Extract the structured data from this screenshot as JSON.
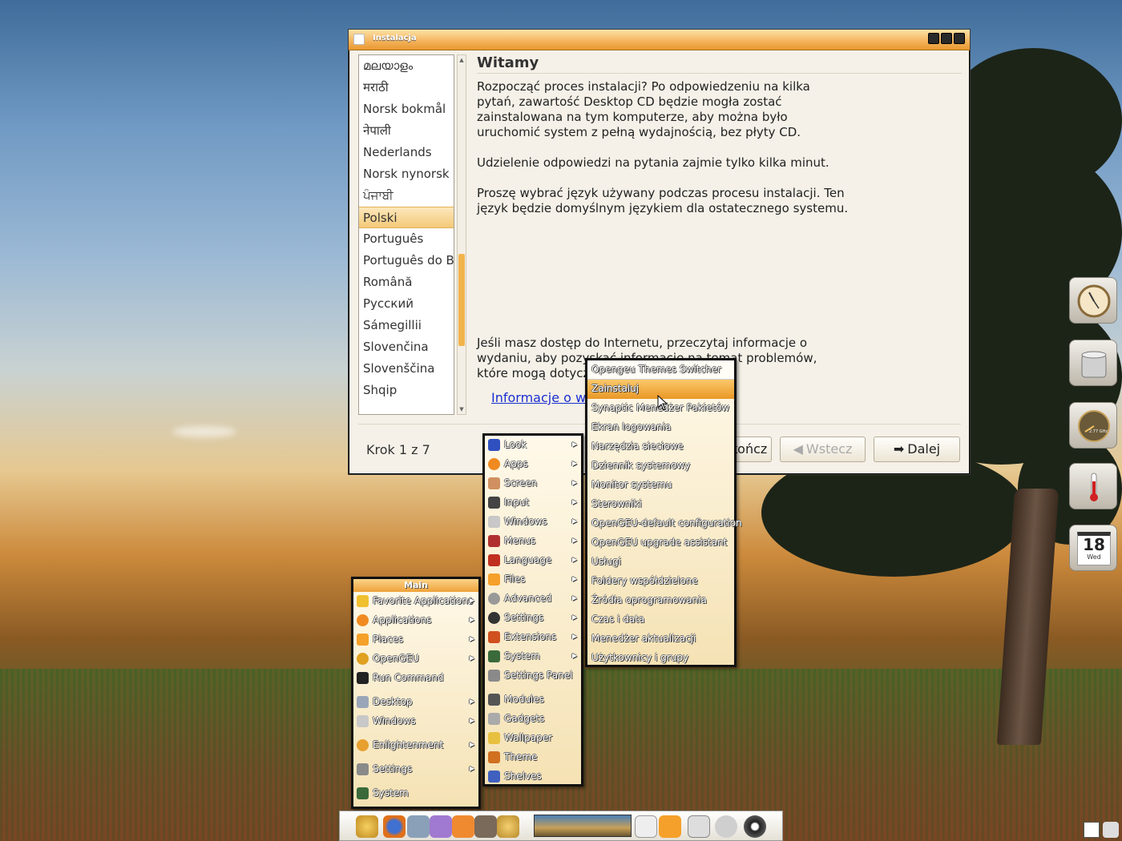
{
  "installer": {
    "title": "Instalacja",
    "languages": [
      "മലയാളം",
      "मराठी",
      "Norsk bokmål",
      "नेपाली",
      "Nederlands",
      "Norsk nynorsk",
      "ਪੰਜਾਬੀ",
      "Polski",
      "Português",
      "Português do Brasil",
      "Română",
      "Русский",
      "Sámegillii",
      "Slovenčina",
      "Slovenščina",
      "Shqip"
    ],
    "selected_language": "Polski",
    "heading": "Witamy",
    "para1": "Rozpocząć proces instalacji? Po odpowiedzeniu na kilka pytań, zawartość Desktop CD będzie mogła zostać zainstalowana na tym komputerze, aby można było uruchomić system z pełną wydajnością, bez płyty CD.",
    "para2": "Udzielenie odpowiedzi na pytania zajmie tylko kilka minut.",
    "para3": "Proszę wybrać język używany podczas procesu instalacji. Ten język będzie domyślnym językiem dla ostatecznego systemu.",
    "para4": "Jeśli masz dostęp do Internetu, przeczytaj informacje o wydaniu, aby pozyskać informacje na temat problemów, które mogą dotyczyć Twojego system.",
    "link": "Informacje o wydaniu",
    "step": "Krok 1 z 7",
    "btn_quit": "Zakończ",
    "btn_back": "Wstecz",
    "btn_next": "Dalej"
  },
  "main_menu": {
    "header": "Main",
    "items": [
      "Favorite Applications",
      "Applications",
      "Places",
      "OpenGEU",
      "Run Command",
      "Desktop",
      "Windows",
      "Enlightenment",
      "Settings",
      "System"
    ]
  },
  "settings_menu": {
    "items": [
      "Look",
      "Apps",
      "Screen",
      "Input",
      "Windows",
      "Menus",
      "Language",
      "Files",
      "Advanced",
      "Settings",
      "Extensions",
      "System",
      "Settings Panel",
      "Modules",
      "Gadgets",
      "Wallpaper",
      "Theme",
      "Shelves"
    ]
  },
  "system_menu": {
    "items": [
      "Opengeu Themes Switcher",
      "Zainstaluj",
      "Synaptic Menedżer Pakietów",
      "Ekran logowania",
      "Narzędzia sieciowe",
      "Dziennik systemowy",
      "Monitor systemu",
      "Sterowniki",
      "OpenGEU-default configuration",
      "OpenGEU upgrade assistant",
      "Usługi",
      "Foldery współdzielone",
      "Źródła oprogramowania",
      "Czas i data",
      "Menedżer aktualizacji",
      "Użytkownicy i grupy"
    ],
    "highlighted": "Zainstaluj"
  },
  "gadgets": {
    "cpu_freq": "2.77 GHz",
    "calendar_day": "18",
    "calendar_weekday": "Wed"
  },
  "colors": {
    "accent": "#f2b44c",
    "menu_bg": "#f7e6bb",
    "link": "#1a2fd0"
  }
}
